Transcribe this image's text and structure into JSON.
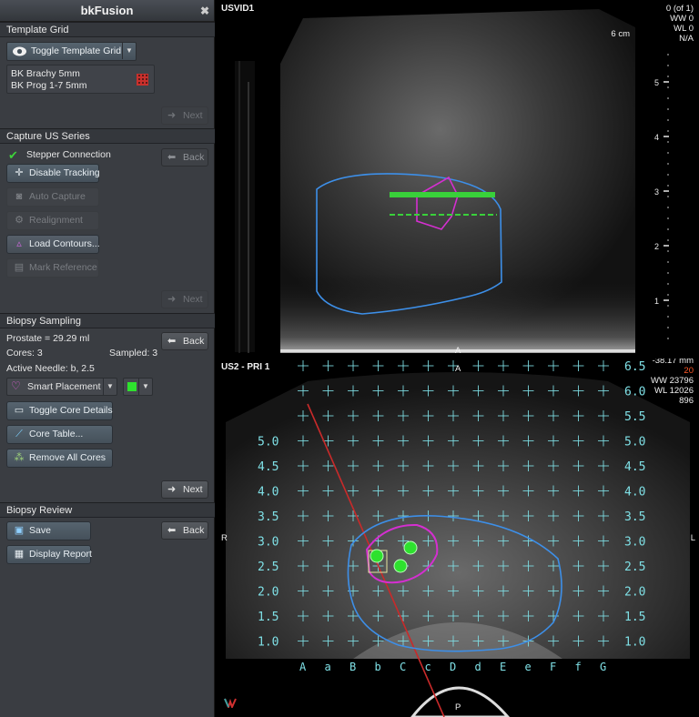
{
  "app": {
    "title": "bkFusion",
    "close_glyph": "✖"
  },
  "template_grid": {
    "header": "Template Grid",
    "toggle_label": "Toggle Template Grid",
    "grids": [
      "BK Brachy 5mm",
      "BK Prog 1-7 5mm"
    ],
    "next_label": "Next"
  },
  "capture": {
    "header": "Capture US Series",
    "stepper_label": "Stepper Connection",
    "back_label": "Back",
    "disable_tracking_label": "Disable Tracking",
    "auto_capture_label": "Auto Capture",
    "realignment_label": "Realignment",
    "load_contours_label": "Load Contours...",
    "mark_reference_label": "Mark Reference",
    "next_label": "Next"
  },
  "biopsy": {
    "header": "Biopsy Sampling",
    "prostate": "Prostate = 29.29 ml",
    "back_label": "Back",
    "cores": "Cores: 3",
    "sampled": "Sampled: 3",
    "active_needle": "Active Needle: b, 2.5",
    "placement_value": "Smart Placement",
    "toggle_core_label": "Toggle Core Details",
    "core_table_label": "Core Table...",
    "remove_cores_label": "Remove All Cores",
    "next_label": "Next"
  },
  "review": {
    "header": "Biopsy Review",
    "save_label": "Save",
    "back_label": "Back",
    "display_report_label": "Display Report"
  },
  "us1": {
    "label": "USVID1",
    "info": [
      "0 (of 1)",
      "WW 0",
      "WL 0",
      "N/A"
    ],
    "depth_label": "6 cm",
    "scale_ticks": [
      "5",
      "4",
      "3",
      "2",
      "1"
    ],
    "bottom_marker": "A",
    "accent_green": "#39d13a",
    "accent_magenta": "#d42fd0",
    "accent_blue": "#3d8fe8"
  },
  "us2": {
    "label": "US2 - PRI 1",
    "info_top": "-38.17 mm",
    "info_red": "20",
    "info": [
      "WW 23796",
      "WL 12026",
      "896"
    ],
    "left_marker": "R",
    "right_marker": "L",
    "bottom_marker": "P",
    "top_marker": "A",
    "row_labels": [
      "6.5",
      "6.0",
      "5.5",
      "5.0",
      "4.5",
      "4.0",
      "3.5",
      "3.0",
      "2.5",
      "2.0",
      "1.5",
      "1.0"
    ],
    "col_labels": [
      "A",
      "a",
      "B",
      "b",
      "C",
      "c",
      "D",
      "d",
      "E",
      "e",
      "F",
      "f",
      "G"
    ],
    "grid_color": "#7fe0e6"
  }
}
